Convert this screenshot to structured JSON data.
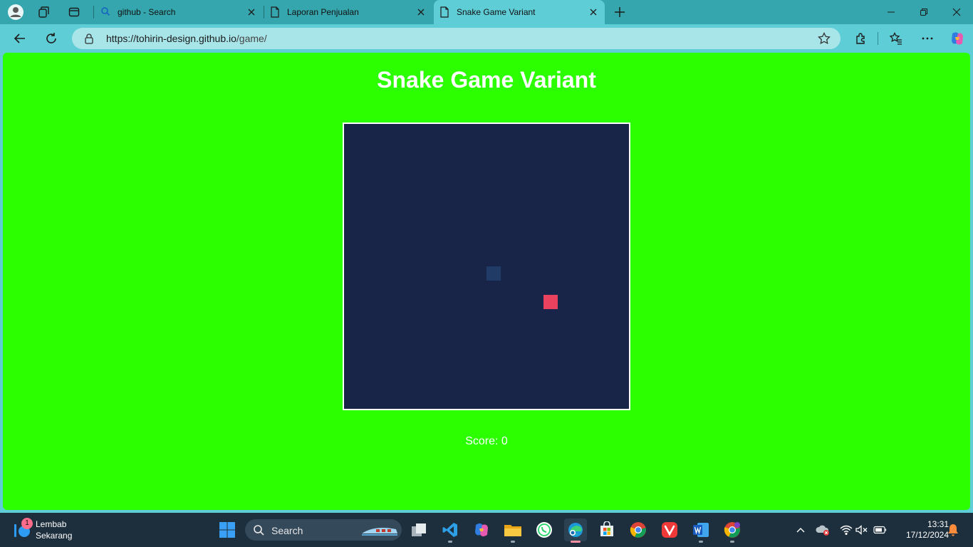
{
  "browser": {
    "tabs": [
      {
        "title": "github - Search",
        "icon": "search-icon"
      },
      {
        "title": "Laporan Penjualan",
        "icon": "page-icon"
      },
      {
        "title": "Snake Game Variant",
        "icon": "page-icon",
        "active": true
      }
    ],
    "url_host": "https://tohirin-design.github.io",
    "url_path": "/game/"
  },
  "page": {
    "title": "Snake Game Variant",
    "score_label": "Score: 0",
    "background_color": "#2bff00",
    "board_color": "#182448",
    "snake_color": "#1f3b66",
    "food_color": "#e8425e"
  },
  "taskbar": {
    "weather": {
      "badge": "1",
      "line1": "Lembab",
      "line2": "Sekarang"
    },
    "search_label": "Search",
    "time": "13:31",
    "date": "17/12/2024"
  }
}
